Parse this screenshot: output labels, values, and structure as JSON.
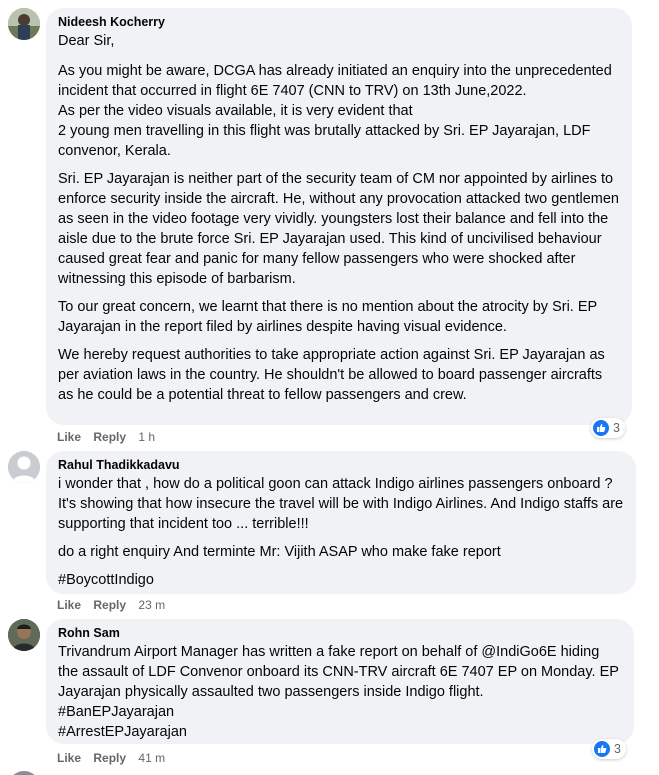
{
  "comments": [
    {
      "author": "Nideesh Kocherry",
      "avatar": "photo-avatar-outdoor",
      "paragraphs": [
        "Dear Sir,",
        "As you might be aware, DCGA has already initiated an enquiry into the unprecedented incident that occurred in flight 6E 7407 (CNN to TRV) on 13th June,2022.",
        "As per the video visuals available, it is very evident that",
        "2 young men travelling in this flight was brutally attacked by Sri. EP Jayarajan, LDF convenor, Kerala.",
        "Sri. EP Jayarajan is neither part of the security team of CM nor appointed by airlines to enforce security inside the aircraft. He, without any provocation attacked two gentlemen as seen in the video footage very vividly. youngsters lost their balance and fell into the aisle due to the brute force Sri. EP Jayarajan used. This kind of uncivilised behaviour caused great fear and panic for many fellow passengers who were shocked after witnessing this episode of barbarism.",
        "To our great concern, we learnt that there is no mention about the atrocity by Sri. EP Jayarajan in the report filed by airlines despite having visual evidence.",
        "We hereby request authorities to take appropriate action against Sri. EP Jayarajan as per aviation laws in the country. He shouldn't be allowed to board passenger aircrafts as he could be a potential threat to fellow passengers and crew."
      ],
      "like_label": "Like",
      "reply_label": "Reply",
      "time": "1 h",
      "reaction_count": "3"
    },
    {
      "author": "Rahul Thadikkadavu",
      "avatar": "default-avatar",
      "paragraphs": [
        "i wonder that , how do a political goon can attack Indigo airlines passengers onboard ? It's showing that how insecure the travel will be with Indigo Airlines. And Indigo staffs are supporting that incident too ... terrible!!!",
        "do a right enquiry And terminte Mr: Vijith ASAP who make fake report",
        "#BoycottIndigo"
      ],
      "like_label": "Like",
      "reply_label": "Reply",
      "time": "23 m"
    },
    {
      "author": "Rohn Sam",
      "avatar": "photo-avatar-person",
      "paragraphs": [
        "Trivandrum Airport Manager has written a fake report on behalf of @IndiGo6E hiding the assault of LDF Convenor onboard its CNN-TRV aircraft 6E 7407 EP on Monday. EP Jayarajan physically assaulted two passengers inside Indigo flight.",
        "#BanEPJayarajan",
        "#ArrestEPJayarajan"
      ],
      "like_label": "Like",
      "reply_label": "Reply",
      "time": "41 m",
      "reaction_count": "3"
    }
  ],
  "colors": {
    "bubble": "#f0f2f5",
    "text": "#050505",
    "secondary": "#65676b",
    "like_blue": "#1877f2"
  },
  "icons": {
    "reaction": "thumbs-up-icon"
  }
}
